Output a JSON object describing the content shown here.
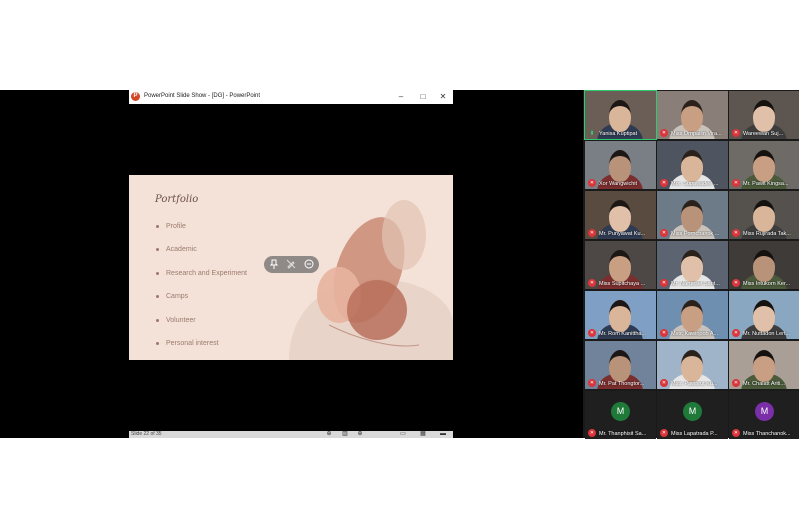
{
  "powerpoint": {
    "window_title": "PowerPoint Slide Show - [DG] - PowerPoint",
    "logo_letter": "P",
    "controls": {
      "minimize": "–",
      "maximize": "□",
      "close": "✕"
    },
    "slide": {
      "title": "Portfolio",
      "bullets": [
        "Profile",
        "Academic",
        "Research and Experiment",
        "Camps",
        "Volunteer",
        "Personal interest"
      ]
    },
    "toolbar_icons": [
      "pin-icon",
      "pen-off-icon",
      "minus-circle-icon"
    ],
    "status": {
      "slide_count": "Slide 22 of 35"
    },
    "colors": {
      "slide_bg": "#f4e2d8",
      "accent_dark": "#b8705c",
      "accent_light": "#e8b49e",
      "text": "#9b7a6d"
    }
  },
  "zoom_gallery": {
    "participants": [
      {
        "name": "Yanisa Kuptipat",
        "video": true,
        "muted": false
      },
      {
        "name": "Miss Ornpailin Vira...",
        "video": true,
        "muted": true
      },
      {
        "name": "Wareewan Suj...",
        "video": true,
        "muted": true
      },
      {
        "name": "Xor Wangwichit",
        "video": true,
        "muted": true
      },
      {
        "name": "Mrs. Supawadee ...",
        "video": true,
        "muted": true
      },
      {
        "name": "Mr. Pawit Kingsa...",
        "video": true,
        "muted": true
      },
      {
        "name": "Mr. Punyawat Ku...",
        "video": true,
        "muted": true
      },
      {
        "name": "Miss Pornchanok ...",
        "video": true,
        "muted": true
      },
      {
        "name": "Miss Rujirada Tak...",
        "video": true,
        "muted": true
      },
      {
        "name": "Miss Supitchaya ...",
        "video": true,
        "muted": true
      },
      {
        "name": "Mr. Narueset Sant...",
        "video": true,
        "muted": true
      },
      {
        "name": "Miss Intukorn Ker...",
        "video": true,
        "muted": true
      },
      {
        "name": "Mr. Rom Kanittha...",
        "video": true,
        "muted": true
      },
      {
        "name": "Mstr. Kawinpob A...",
        "video": true,
        "muted": true
      },
      {
        "name": "Mr. Nuttadon Lert...",
        "video": true,
        "muted": true
      },
      {
        "name": "Mr. Pat Thongtor...",
        "video": true,
        "muted": true
      },
      {
        "name": "Mstr. Pawarut Ku...",
        "video": true,
        "muted": true
      },
      {
        "name": "Mr. Chalatt Ariti...",
        "video": true,
        "muted": true
      },
      {
        "name": "Mr. Thanphisit Sa...",
        "video": false,
        "muted": true,
        "initial": "M",
        "avatar_color": "#1f7a3a"
      },
      {
        "name": "Miss Lapatrada P...",
        "video": false,
        "muted": true,
        "initial": "M",
        "avatar_color": "#1f7a3a"
      },
      {
        "name": "Miss Thanchanok...",
        "video": false,
        "muted": true,
        "initial": "M",
        "avatar_color": "#7a2ea8"
      }
    ]
  }
}
